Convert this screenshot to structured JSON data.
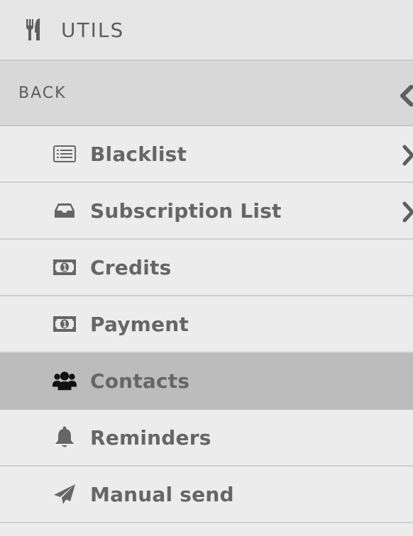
{
  "header": {
    "title": "UTILS",
    "icon": "utensils-icon"
  },
  "back": {
    "label": "BACK",
    "icon": "chevron-left-icon"
  },
  "items": [
    {
      "label": "Blacklist",
      "icon": "list-icon",
      "has_submenu": true,
      "active": false
    },
    {
      "label": "Subscription List",
      "icon": "inbox-icon",
      "has_submenu": true,
      "active": false
    },
    {
      "label": "Credits",
      "icon": "money-icon",
      "has_submenu": false,
      "active": false
    },
    {
      "label": "Payment",
      "icon": "money-icon",
      "has_submenu": false,
      "active": false
    },
    {
      "label": "Contacts",
      "icon": "users-icon",
      "has_submenu": false,
      "active": true
    },
    {
      "label": "Reminders",
      "icon": "bell-icon",
      "has_submenu": false,
      "active": false
    },
    {
      "label": "Manual send",
      "icon": "paper-plane-icon",
      "has_submenu": false,
      "active": false
    }
  ],
  "colors": {
    "background": "#ececec",
    "header_bg": "#e6e6e6",
    "back_bg": "#d8d8d8",
    "active_bg": "#bcbcbc",
    "text": "#666666"
  }
}
